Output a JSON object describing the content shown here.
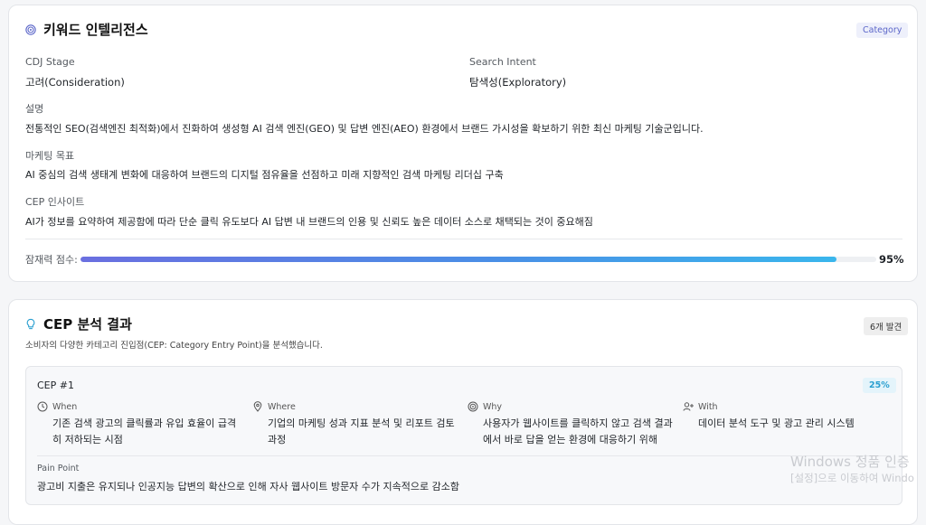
{
  "keyword_card": {
    "title": "키워드 인텔리전스",
    "badge": "Category",
    "cdj_stage_label": "CDJ Stage",
    "cdj_stage_value": "고려(Consideration)",
    "search_intent_label": "Search Intent",
    "search_intent_value": "탐색성(Exploratory)",
    "description_label": "설명",
    "description_value": "전통적인 SEO(검색엔진 최적화)에서 진화하여 생성형 AI 검색 엔진(GEO) 및 답변 엔진(AEO) 환경에서 브랜드 가시성을 확보하기 위한 최신 마케팅 기술군입니다.",
    "goal_label": "마케팅 목표",
    "goal_value": "AI 중심의 검색 생태계 변화에 대응하여 브랜드의 디지털 점유율을 선점하고 미래 지향적인 검색 마케팅 리더십 구축",
    "insight_label": "CEP 인사이트",
    "insight_value": "AI가 정보를 요약하여 제공함에 따라 단순 클릭 유도보다 AI 답변 내 브랜드의 인용 및 신뢰도 높은 데이터 소스로 채택되는 것이 중요해짐",
    "potential_label": "잠재력 점수:",
    "potential_value": 95,
    "potential_text": "95%"
  },
  "cep_card": {
    "title": "CEP 분석 결과",
    "badge": "6개 발견",
    "subtitle": "소비자의 다양한 카테고리 진입점(CEP: Category Entry Point)을 분석했습니다.",
    "items": [
      {
        "title": "CEP #1",
        "percent": "25%",
        "when_label": "When",
        "when_value": "기존 검색 광고의 클릭률과 유입 효율이 급격히 저하되는 시점",
        "where_label": "Where",
        "where_value": "기업의 마케팅 성과 지표 분석 및 리포트 검토 과정",
        "why_label": "Why",
        "why_value": "사용자가 웹사이트를 클릭하지 않고 검색 결과에서 바로 답을 얻는 환경에 대응하기 위해",
        "with_label": "With",
        "with_value": "데이터 분석 도구 및 광고 관리 시스템",
        "pain_label": "Pain Point",
        "pain_value": "광고비 지출은 유지되나 인공지능 답변의 확산으로 인해 자사 웹사이트 방문자 수가 지속적으로 감소함"
      }
    ]
  },
  "watermark": {
    "line1": "Windows 정품 인증",
    "line2": "[설정]으로 이동하여 Windo"
  },
  "colors": {
    "accent": "#5b66c9",
    "progress_start": "#6a6fe0",
    "progress_end": "#3ab6ec",
    "percent_badge": "#2a9fd0"
  }
}
